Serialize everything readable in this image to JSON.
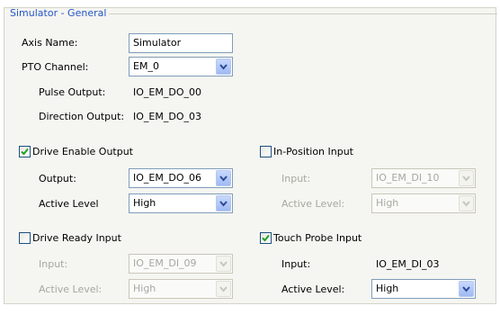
{
  "group": {
    "title": "Simulator - General"
  },
  "axis_name": {
    "label": "Axis Name:",
    "value": "Simulator"
  },
  "pto_channel": {
    "label": "PTO Channel:",
    "value": "EM_0"
  },
  "pulse_output": {
    "label": "Pulse Output:",
    "value": "IO_EM_DO_00"
  },
  "direction_output": {
    "label": "Direction Output:",
    "value": "IO_EM_DO_03"
  },
  "drive_enable": {
    "label": "Drive Enable Output",
    "checked": true,
    "output_label": "Output:",
    "output_value": "IO_EM_DO_06",
    "level_label": "Active Level",
    "level_value": "High"
  },
  "in_position": {
    "label": "In-Position Input",
    "checked": false,
    "input_label": "Input:",
    "input_value": "IO_EM_DI_10",
    "level_label": "Active Level:",
    "level_value": "High"
  },
  "drive_ready": {
    "label": "Drive Ready Input",
    "checked": false,
    "input_label": "Input:",
    "input_value": "IO_EM_DI_09",
    "level_label": "Active Level:",
    "level_value": "High"
  },
  "touch_probe": {
    "label": "Touch Probe Input",
    "checked": true,
    "input_label": "Input:",
    "input_value": "IO_EM_DI_03",
    "level_label": "Active Level:",
    "level_value": "High"
  },
  "colors": {
    "group_title": "#2456c8",
    "panel_bg": "#f5f5f1",
    "field_border": "#7f9db9",
    "check_mark": "#21a121"
  }
}
